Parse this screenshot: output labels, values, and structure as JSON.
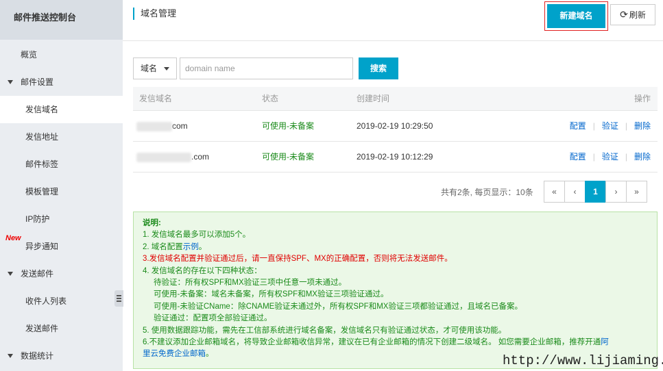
{
  "sidebar": {
    "title": "邮件推送控制台",
    "items": [
      {
        "label": "概览"
      },
      {
        "label": "邮件设置"
      },
      {
        "label": "发信域名"
      },
      {
        "label": "发信地址"
      },
      {
        "label": "邮件标签"
      },
      {
        "label": "模板管理"
      },
      {
        "label": "IP防护"
      },
      {
        "label": "异步通知",
        "badge": "New"
      },
      {
        "label": "发送邮件"
      },
      {
        "label": "收件人列表"
      },
      {
        "label": "发送邮件"
      },
      {
        "label": "数据统计"
      }
    ]
  },
  "header": {
    "title": "域名管理",
    "new_button": "新建域名",
    "refresh_button": "刷新",
    "refresh_icon": "refresh-icon"
  },
  "search": {
    "field_select": "域名",
    "placeholder": "domain name",
    "button": "搜索"
  },
  "table": {
    "columns": [
      "发信域名",
      "状态",
      "创建时间",
      "操作"
    ],
    "rows": [
      {
        "domain": "com",
        "status": "可使用-未备案",
        "created": "2019-02-19 10:29:50",
        "ops": [
          "配置",
          "验证",
          "删除"
        ]
      },
      {
        "domain": ".com",
        "status": "可使用-未备案",
        "created": "2019-02-19 10:12:29",
        "ops": [
          "配置",
          "验证",
          "删除"
        ]
      }
    ]
  },
  "pagination": {
    "info": "共有2条, 每页显示：10条",
    "first": "«",
    "prev": "‹",
    "current": "1",
    "next": "›",
    "last": "»"
  },
  "notice": {
    "title": "说明:",
    "l1": "1. 发信域名最多可以添加5个。",
    "l2a": "2. 域名配置",
    "l2b": "示例",
    "l2c": "。",
    "l3": "3.发信域名配置并验证通过后，请一直保持SPF、MX的正确配置，否则将无法发送邮件。",
    "l4": "4. 发信域名的存在以下四种状态：",
    "l4a": "待验证：所有权SPF和MX验证三项中任意一项未通过。",
    "l4b": "可使用-未备案：域名未备案，所有权SPF和MX验证三项验证通过。",
    "l4c": "可使用-未验证CName：除CNAME验证未通过外，所有权SPF和MX验证三项都验证通过，且域名已备案。",
    "l4d": "验证通过：配置项全部验证通过。",
    "l5": "5. 使用数据跟踪功能，需先在工信部系统进行域名备案，发信域名只有验证通过状态，才可使用该功能。",
    "l6a": "6.不建议添加企业邮箱域名，将导致企业邮箱收信异常，建议在已有企业邮箱的情况下创建二级域名。 如您需要企业邮箱，推荐开通",
    "l6b": "阿",
    "l6c": "里云免费企业邮箱",
    "l6d": "。"
  },
  "watermark": "http://www.lijiaming.net"
}
